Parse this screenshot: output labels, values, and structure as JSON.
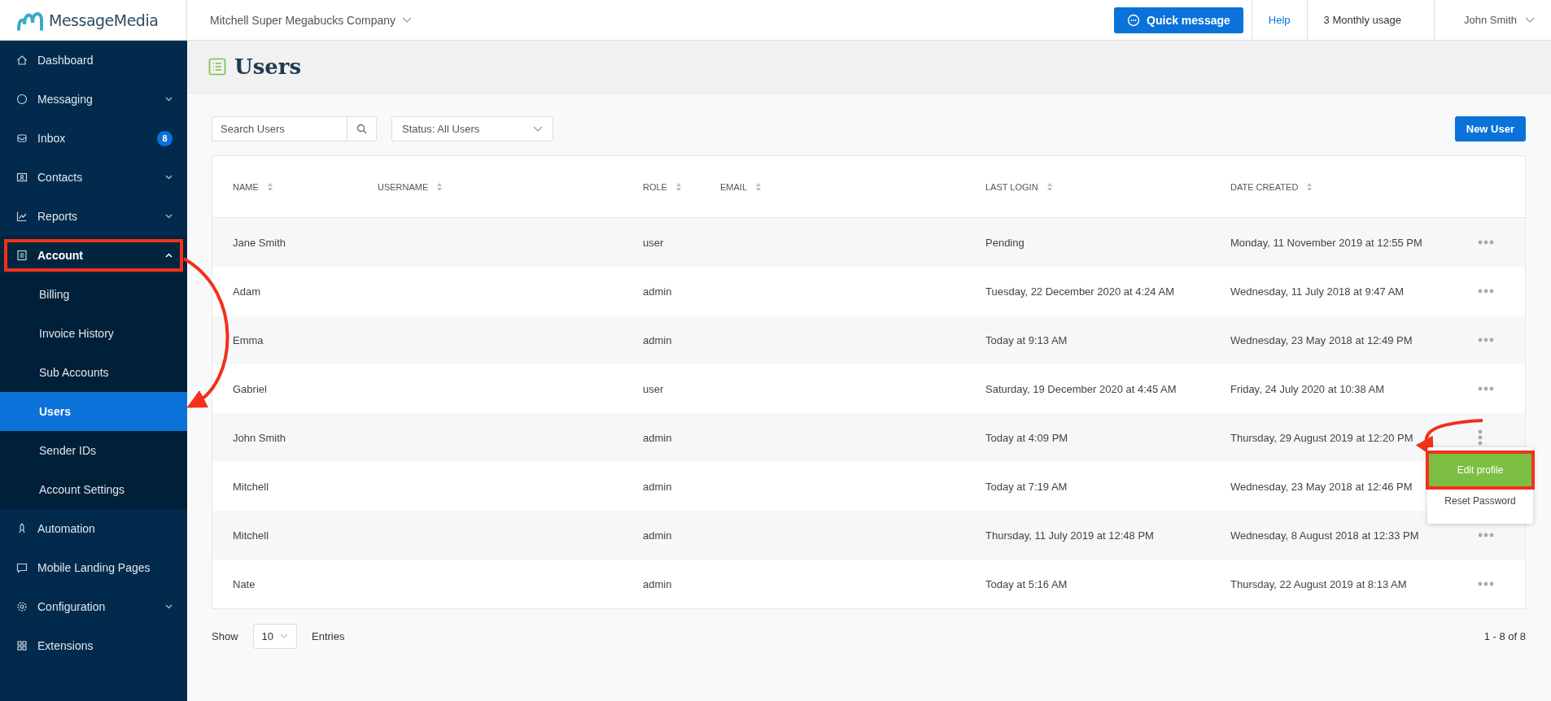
{
  "brand": {
    "name": "MessageMedia"
  },
  "topbar": {
    "company": "Mitchell Super Megabucks Company",
    "quick_message": "Quick message",
    "help": "Help",
    "usage": "3 Monthly usage",
    "user": "John Smith"
  },
  "sidebar": {
    "items": [
      {
        "label": "Dashboard",
        "selected": false
      },
      {
        "label": "Messaging",
        "selected": false,
        "expanded": false
      },
      {
        "label": "Inbox",
        "selected": false,
        "badge": "8"
      },
      {
        "label": "Contacts",
        "selected": false,
        "expanded": false
      },
      {
        "label": "Reports",
        "selected": false,
        "expanded": false
      },
      {
        "label": "Account",
        "selected": false,
        "expanded": true,
        "highlighted": true,
        "children": [
          {
            "label": "Billing",
            "selected": false
          },
          {
            "label": "Invoice History",
            "selected": false
          },
          {
            "label": "Sub Accounts",
            "selected": false
          },
          {
            "label": "Users",
            "selected": true
          },
          {
            "label": "Sender IDs",
            "selected": false
          },
          {
            "label": "Account Settings",
            "selected": false
          }
        ]
      },
      {
        "label": "Automation",
        "selected": false
      },
      {
        "label": "Mobile Landing Pages",
        "selected": false
      },
      {
        "label": "Configuration",
        "selected": false,
        "expanded": false
      },
      {
        "label": "Extensions",
        "selected": false
      }
    ]
  },
  "page": {
    "title": "Users"
  },
  "toolbar": {
    "search": {
      "placeholder": "Search Users"
    },
    "status_filter": "Status: All Users",
    "new_user": "New User"
  },
  "table": {
    "columns": [
      "NAME",
      "USERNAME",
      "ROLE",
      "EMAIL",
      "LAST LOGIN",
      "DATE CREATED"
    ],
    "rows": [
      {
        "name": "Jane Smith",
        "role": "user",
        "last_login": "Pending",
        "date_created": "Monday, 11 November 2019 at 12:55 PM",
        "menu_open": false
      },
      {
        "name": "Adam",
        "role": "admin",
        "last_login": "Tuesday, 22 December 2020 at 4:24 AM",
        "date_created": "Wednesday, 11 July 2018 at 9:47 AM",
        "menu_open": false
      },
      {
        "name": "Emma",
        "role": "admin",
        "last_login": "Today at 9:13 AM",
        "date_created": "Wednesday, 23 May 2018 at 12:49 PM",
        "menu_open": false
      },
      {
        "name": "Gabriel",
        "role": "user",
        "last_login": "Saturday, 19 December 2020 at 4:45 AM",
        "date_created": "Friday, 24 July 2020 at 10:38 AM",
        "menu_open": false
      },
      {
        "name": "John Smith",
        "role": "admin",
        "last_login": "Today at 4:09 PM",
        "date_created": "Thursday, 29 August 2019 at 12:20 PM",
        "menu_open": true
      },
      {
        "name": "Mitchell",
        "role": "admin",
        "last_login": "Today at 7:19 AM",
        "date_created": "Wednesday, 23 May 2018 at 12:46 PM",
        "menu_open": false
      },
      {
        "name": "Mitchell",
        "role": "admin",
        "last_login": "Thursday, 11 July 2019 at 12:48 PM",
        "date_created": "Wednesday, 8 August 2018 at 12:33 PM",
        "menu_open": false
      },
      {
        "name": "Nate",
        "role": "admin",
        "last_login": "Today at 5:16 AM",
        "date_created": "Thursday, 22 August 2019 at 8:13 AM",
        "menu_open": false
      }
    ]
  },
  "row_menu": {
    "items": [
      {
        "label": "Edit profile",
        "highlighted": true
      },
      {
        "label": "Reset Password",
        "highlighted": false
      }
    ]
  },
  "footer": {
    "show": "Show",
    "page_size": "10",
    "entries": "Entries",
    "range": "1 - 8 of 8"
  }
}
